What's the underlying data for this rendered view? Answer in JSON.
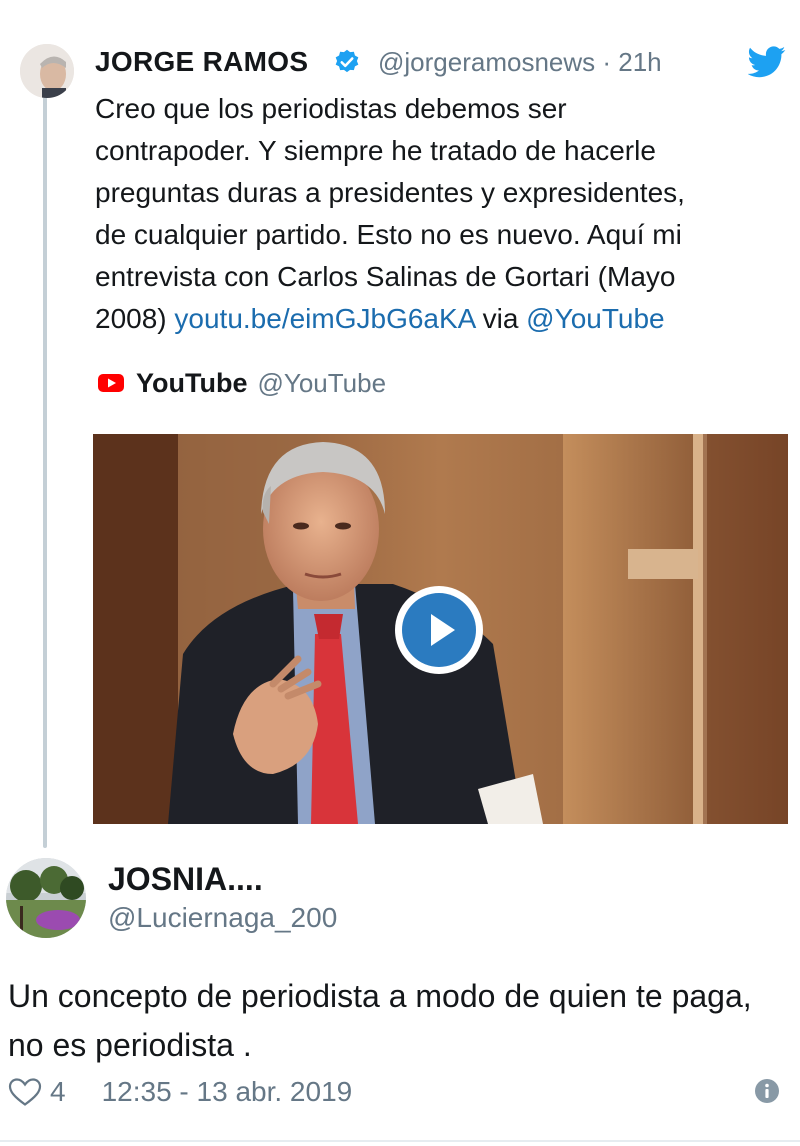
{
  "quoted_tweet": {
    "author_name": "JORGE RAMOS",
    "handle_time": "@jorgeramosnews · 21h",
    "text_plain": "Creo que los periodistas debemos ser\ncontrapoder. Y siempre he tratado de hacerle\npreguntas duras a presidentes y expresidentes,\nde cualquier partido. Esto no es nuevo. Aquí mi\nentrevista con Carlos Salinas de Gortari (Mayo\n2008) ",
    "link": "youtu.be/eimGJbG6aKA",
    "via": " via ",
    "mention": "@YouTube",
    "card": {
      "source_name": "YouTube",
      "source_handle": "@YouTube",
      "media": "video-thumbnail",
      "play_icon": "play-icon"
    }
  },
  "reply": {
    "author_name": "JOSNIA....",
    "handle": "@Luciernaga_200",
    "text": "Un concepto de periodista a modo de quien te paga, no es periodista .",
    "likes": "4",
    "timestamp": "12:35 - 13 abr. 2019"
  },
  "icons": {
    "verified": "verified-badge-icon",
    "brand": "twitter-bird-icon",
    "like": "heart-icon",
    "info": "info-icon"
  },
  "colors": {
    "link": "#1b6cae",
    "secondary_text": "#657786",
    "twitter_blue": "#1da1f2",
    "youtube_red": "#ff0000",
    "play_button": "#2b7bc0"
  }
}
